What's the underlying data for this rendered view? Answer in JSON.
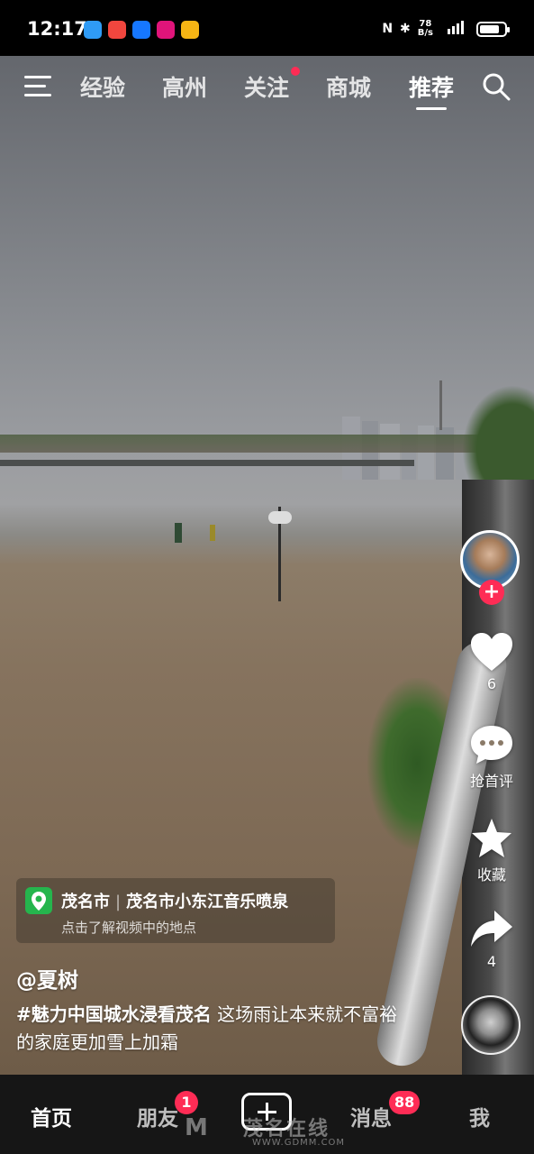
{
  "status_bar": {
    "time": "12:17",
    "network_speed_value": "78",
    "network_speed_unit": "B/s",
    "signal": "4G",
    "battery_percent": 70
  },
  "top_nav": {
    "tabs": [
      "经验",
      "高州",
      "关注",
      "商城",
      "推荐"
    ],
    "active_tab": "推荐"
  },
  "side_actions": {
    "follow": "+",
    "like_count": "6",
    "comment_label": "抢首评",
    "favorite_label": "收藏",
    "share_count": "4"
  },
  "location": {
    "city": "茂名市",
    "place": "茂名市小东江音乐喷泉",
    "hint": "点击了解视频中的地点"
  },
  "post": {
    "author": "@夏树",
    "hashtag": "#魅力中国城水浸看茂名",
    "text": " 这场雨让本来就不富裕的家庭更加雪上加霜"
  },
  "bottom_nav": {
    "home": "首页",
    "friends": "朋友",
    "friends_badge": "1",
    "add": "+",
    "messages": "消息",
    "messages_badge": "88",
    "me": "我"
  },
  "watermark": {
    "text": "茂名在线",
    "url": "WWW.GDMM.COM"
  },
  "colors": {
    "accent": "#fe2c55",
    "location_pin": "#25b54d",
    "nav_bg": "#161616"
  }
}
